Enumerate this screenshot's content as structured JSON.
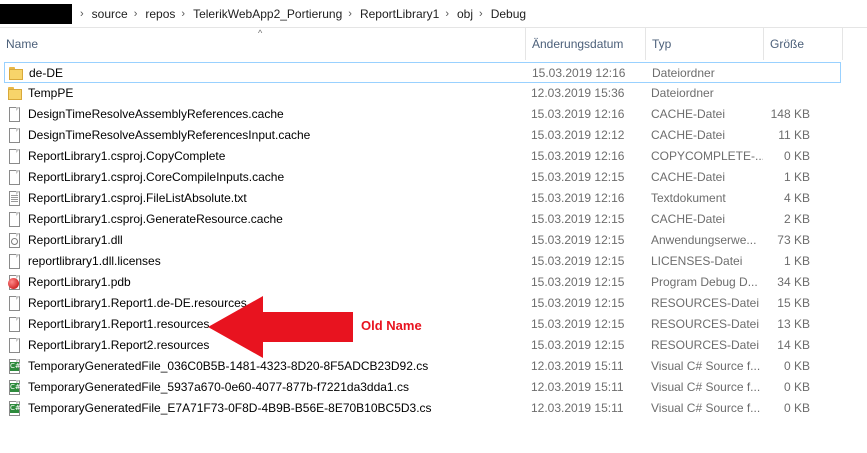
{
  "address_bar": {
    "breadcrumbs": [
      "source",
      "repos",
      "TelerikWebApp2_Portierung",
      "ReportLibrary1",
      "obj",
      "Debug"
    ]
  },
  "columns": {
    "name": "Name",
    "date": "Änderungsdatum",
    "type": "Typ",
    "size": "Größe"
  },
  "sort_caret": "^",
  "files": [
    {
      "icon": "folder-icon",
      "name": "de-DE",
      "date": "15.03.2019 12:16",
      "type": "Dateiordner",
      "size": ""
    },
    {
      "icon": "folder-icon",
      "name": "TempPE",
      "date": "12.03.2019 15:36",
      "type": "Dateiordner",
      "size": ""
    },
    {
      "icon": "file-icon",
      "name": "DesignTimeResolveAssemblyReferences.cache",
      "date": "15.03.2019 12:16",
      "type": "CACHE-Datei",
      "size": "148 KB"
    },
    {
      "icon": "file-icon",
      "name": "DesignTimeResolveAssemblyReferencesInput.cache",
      "date": "15.03.2019 12:12",
      "type": "CACHE-Datei",
      "size": "11 KB"
    },
    {
      "icon": "file-icon",
      "name": "ReportLibrary1.csproj.CopyComplete",
      "date": "15.03.2019 12:16",
      "type": "COPYCOMPLETE-...",
      "size": "0 KB"
    },
    {
      "icon": "file-icon",
      "name": "ReportLibrary1.csproj.CoreCompileInputs.cache",
      "date": "15.03.2019 12:15",
      "type": "CACHE-Datei",
      "size": "1 KB"
    },
    {
      "icon": "text-file-icon",
      "name": "ReportLibrary1.csproj.FileListAbsolute.txt",
      "date": "15.03.2019 12:16",
      "type": "Textdokument",
      "size": "4 KB"
    },
    {
      "icon": "file-icon",
      "name": "ReportLibrary1.csproj.GenerateResource.cache",
      "date": "15.03.2019 12:15",
      "type": "CACHE-Datei",
      "size": "2 KB"
    },
    {
      "icon": "dll-icon",
      "name": "ReportLibrary1.dll",
      "date": "15.03.2019 12:15",
      "type": "Anwendungserwe...",
      "size": "73 KB"
    },
    {
      "icon": "file-icon",
      "name": "reportlibrary1.dll.licenses",
      "date": "15.03.2019 12:15",
      "type": "LICENSES-Datei",
      "size": "1 KB"
    },
    {
      "icon": "pdb-icon",
      "name": "ReportLibrary1.pdb",
      "date": "15.03.2019 12:15",
      "type": "Program Debug D...",
      "size": "34 KB"
    },
    {
      "icon": "file-icon",
      "name": "ReportLibrary1.Report1.de-DE.resources",
      "date": "15.03.2019 12:15",
      "type": "RESOURCES-Datei",
      "size": "15 KB"
    },
    {
      "icon": "file-icon",
      "name": "ReportLibrary1.Report1.resources",
      "date": "15.03.2019 12:15",
      "type": "RESOURCES-Datei",
      "size": "13 KB"
    },
    {
      "icon": "file-icon",
      "name": "ReportLibrary1.Report2.resources",
      "date": "15.03.2019 12:15",
      "type": "RESOURCES-Datei",
      "size": "14 KB"
    },
    {
      "icon": "csharp-file-icon",
      "name": "TemporaryGeneratedFile_036C0B5B-1481-4323-8D20-8F5ADCB23D92.cs",
      "date": "12.03.2019 15:11",
      "type": "Visual C# Source f...",
      "size": "0 KB"
    },
    {
      "icon": "csharp-file-icon",
      "name": "TemporaryGeneratedFile_5937a670-0e60-4077-877b-f7221da3dda1.cs",
      "date": "12.03.2019 15:11",
      "type": "Visual C# Source f...",
      "size": "0 KB"
    },
    {
      "icon": "csharp-file-icon",
      "name": "TemporaryGeneratedFile_E7A71F73-0F8D-4B9B-B56E-8E70B10BC5D3.cs",
      "date": "12.03.2019 15:11",
      "type": "Visual C# Source f...",
      "size": "0 KB"
    }
  ],
  "selected_row": 0,
  "annotation": {
    "label": "Old Name",
    "color": "#e8131f",
    "points_to": "ReportLibrary1.Report1.resources"
  }
}
